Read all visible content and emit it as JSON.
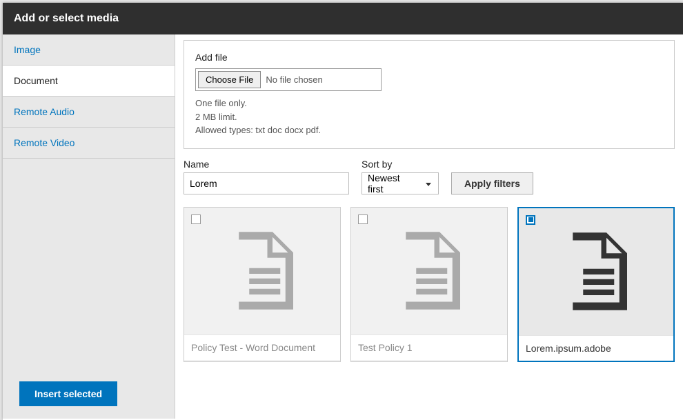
{
  "dialog": {
    "title": "Add or select media"
  },
  "tabs": {
    "items": [
      {
        "label": "Image"
      },
      {
        "label": "Document"
      },
      {
        "label": "Remote Audio"
      },
      {
        "label": "Remote Video"
      }
    ],
    "active_index": 1
  },
  "upload": {
    "label": "Add file",
    "button": "Choose File",
    "status": "No file chosen",
    "hints": [
      "One file only.",
      "2 MB limit.",
      "Allowed types: txt doc docx pdf."
    ]
  },
  "filters": {
    "name_label": "Name",
    "name_value": "Lorem",
    "sort_label": "Sort by",
    "sort_value": "Newest first",
    "apply": "Apply filters"
  },
  "results": {
    "items": [
      {
        "title": "Policy Test - Word Document",
        "selected": false
      },
      {
        "title": "Test Policy 1",
        "selected": false
      },
      {
        "title": "Lorem.ipsum.adobe",
        "selected": true
      }
    ]
  },
  "actions": {
    "insert": "Insert selected"
  }
}
